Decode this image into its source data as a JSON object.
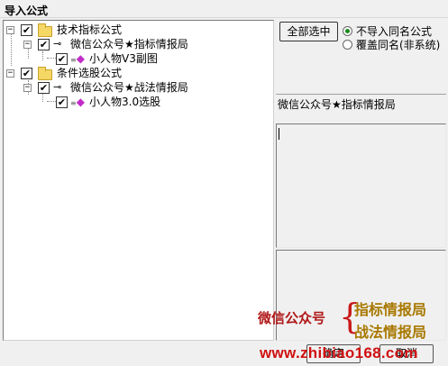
{
  "window": {
    "title": "导入公式"
  },
  "tree": {
    "groups": [
      {
        "label": "技术指标公式",
        "children": [
          {
            "label": "微信公众号★指标情报局",
            "children": [
              {
                "label": "小人物V3副图"
              }
            ]
          }
        ]
      },
      {
        "label": "条件选股公式",
        "children": [
          {
            "label": "微信公众号★战法情报局",
            "children": [
              {
                "label": "小人物3.0选股"
              }
            ]
          }
        ]
      }
    ]
  },
  "expander_symbol": "−",
  "check_symbol": "✔",
  "buttons": {
    "select_all": "全部选中",
    "ok": "确定",
    "cancel": "取消"
  },
  "options": [
    {
      "label": "不导入同名公式",
      "selected": true
    },
    {
      "label": "覆盖同名(非系统)",
      "selected": false
    }
  ],
  "selected_name": "微信公众号★指标情报局",
  "description": "",
  "watermark": {
    "left": "微信公众号",
    "brace": "{",
    "right_line1": "指标情报局",
    "right_line2": "战法情报局",
    "url": "www.zhibiao168.com"
  },
  "colors": {
    "accent_green": "#1a8a1a",
    "formula_icon": "#c02cc8",
    "folder": "#f5d766",
    "watermark_red": "#b01818",
    "watermark_gold": "#a87800"
  },
  "icons": {
    "folder": "folder-icon",
    "sub_group": "key-icon",
    "formula": "formula-gem-icon"
  }
}
